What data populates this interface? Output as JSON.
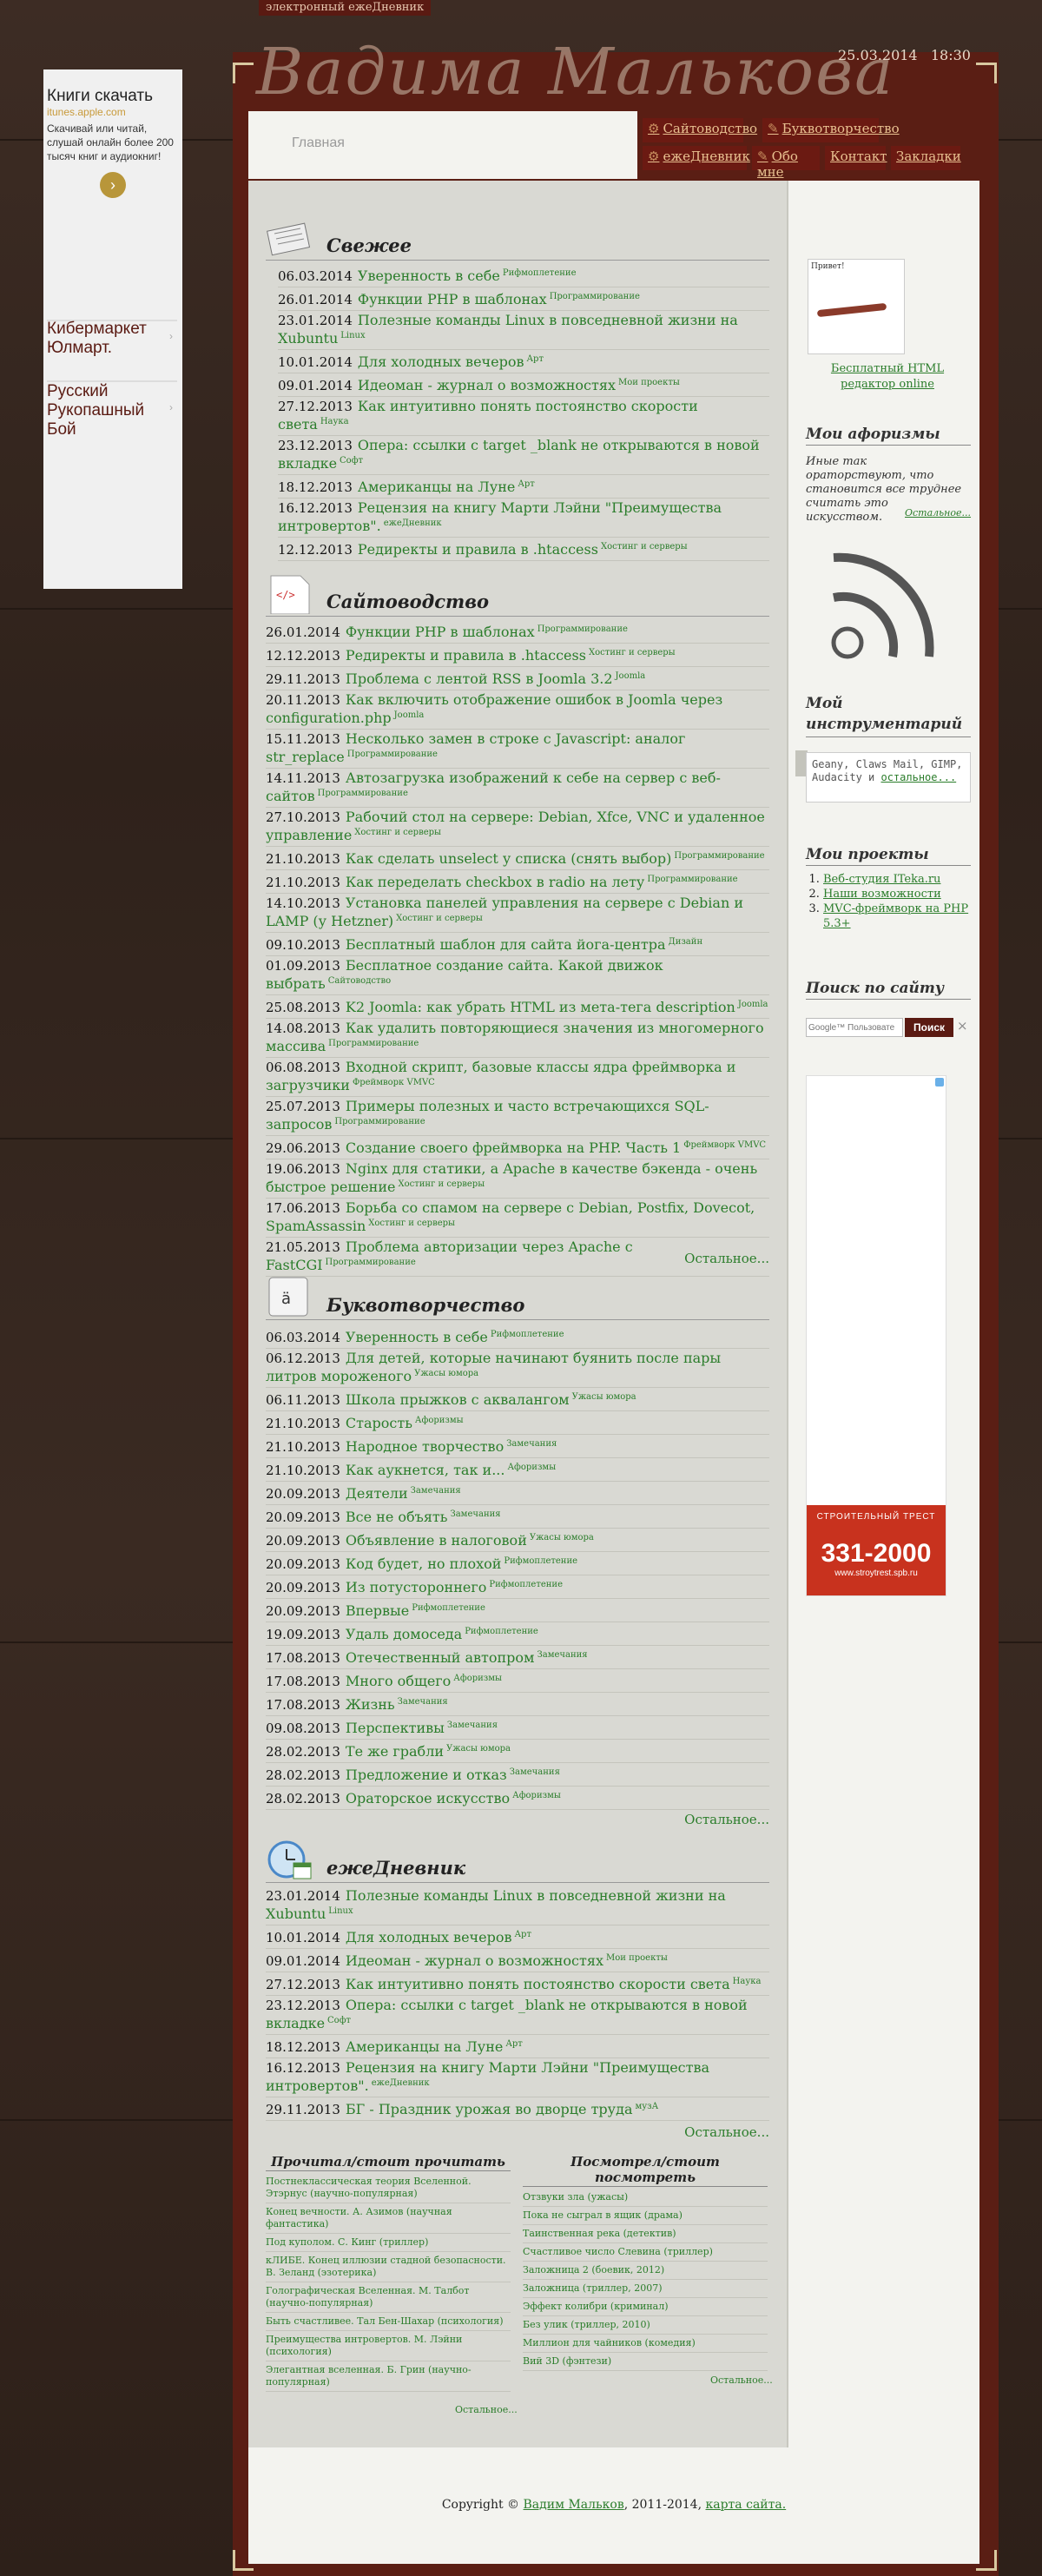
{
  "site": {
    "top_label": "электронный ежеДневник",
    "logo": "Вадима Малькова",
    "date": "25.03.2014",
    "time": "18:30",
    "home": "Главная"
  },
  "nav": [
    {
      "label": "Сайтоводство"
    },
    {
      "label": "Буквотворчество"
    },
    {
      "label": "ежеДневник"
    },
    {
      "label": "Обо мне"
    },
    {
      "label": "Контакт"
    },
    {
      "label": "Закладки"
    }
  ],
  "left_ad": {
    "title": "Книги скачать",
    "domain": "itunes.apple.com",
    "text": "Скачивай или читай, слушай онлайн более 200 тысяч книг и аудиокниг!",
    "link1": "Кибермаркет Юлмарт.",
    "link2": "Русский Рукопашный Бой"
  },
  "fresh": {
    "title": "Свежее",
    "items": [
      {
        "date": "06.03.2014",
        "title": "Уверенность в себе",
        "tag": "Рифмоплетение"
      },
      {
        "date": "26.01.2014",
        "title": "Функции PHP в шаблонах",
        "tag": "Программирование"
      },
      {
        "date": "23.01.2014",
        "title": "Полезные команды Linux в повседневной жизни на Xubuntu",
        "tag": "Linux"
      },
      {
        "date": "10.01.2014",
        "title": "Для холодных вечеров",
        "tag": "Арт"
      },
      {
        "date": "09.01.2014",
        "title": "Идеоман - журнал о возможностях",
        "tag": "Мои проекты"
      },
      {
        "date": "27.12.2013",
        "title": "Как интуитивно понять постоянство скорости света",
        "tag": "Наука"
      },
      {
        "date": "23.12.2013",
        "title": "Опера: ссылки с target _blank не открываются в новой вкладке",
        "tag": "Софт"
      },
      {
        "date": "18.12.2013",
        "title": "Американцы на Луне",
        "tag": "Арт"
      },
      {
        "date": "16.12.2013",
        "title": "Рецензия на книгу Марти Лэйни \"Преимущества интровертов\".",
        "tag": "ежеДневник"
      },
      {
        "date": "12.12.2013",
        "title": "Редиректы и правила в .htaccess",
        "tag": "Хостинг и серверы"
      }
    ]
  },
  "web": {
    "title": "Сайтоводство",
    "more": "Остальное...",
    "items": [
      {
        "date": "26.01.2014",
        "title": "Функции PHP в шаблонах",
        "tag": "Программирование"
      },
      {
        "date": "12.12.2013",
        "title": "Редиректы и правила в .htaccess",
        "tag": "Хостинг и серверы"
      },
      {
        "date": "29.11.2013",
        "title": "Проблема с лентой RSS в Joomla 3.2",
        "tag": "Joomla"
      },
      {
        "date": "20.11.2013",
        "title": "Как включить отображение ошибок в Joomla через configuration.php",
        "tag": "Joomla"
      },
      {
        "date": "15.11.2013",
        "title": "Несколько замен в строке с Javascript: аналог str_replace",
        "tag": "Программирование"
      },
      {
        "date": "14.11.2013",
        "title": "Автозагрузка изображений к себе на сервер с веб-сайтов",
        "tag": "Программирование"
      },
      {
        "date": "27.10.2013",
        "title": "Рабочий стол на сервере: Debian, Xfce, VNC и удаленное управление",
        "tag": "Хостинг и серверы"
      },
      {
        "date": "21.10.2013",
        "title": "Как сделать unselect у списка (снять выбор)",
        "tag": "Программирование"
      },
      {
        "date": "21.10.2013",
        "title": "Как переделать checkbox в radio на лету",
        "tag": "Программирование"
      },
      {
        "date": "14.10.2013",
        "title": "Установка панелей управления на сервере с Debian и LAMP (у Hetzner)",
        "tag": "Хостинг и серверы"
      },
      {
        "date": "09.10.2013",
        "title": "Бесплатный шаблон для сайта йога-центра",
        "tag": "Дизайн"
      },
      {
        "date": "01.09.2013",
        "title": "Бесплатное создание сайта. Какой движок выбрать",
        "tag": "Сайтоводство"
      },
      {
        "date": "25.08.2013",
        "title": "K2 Joomla: как убрать HTML из мета-тега description",
        "tag": "Joomla"
      },
      {
        "date": "14.08.2013",
        "title": "Как удалить повторяющиеся значения из многомерного массива",
        "tag": "Программирование"
      },
      {
        "date": "06.08.2013",
        "title": "Входной скрипт, базовые классы ядра фреймворка и загрузчики",
        "tag": "Фреймворк VMVC"
      },
      {
        "date": "25.07.2013",
        "title": "Примеры полезных и часто встречающихся SQL-запросов",
        "tag": "Программирование"
      },
      {
        "date": "29.06.2013",
        "title": "Создание своего фреймворка на PHP. Часть 1",
        "tag": "Фреймворк VMVC"
      },
      {
        "date": "19.06.2013",
        "title": "Nginx для статики, а Apache в качестве бэкенда - очень быстрое решение",
        "tag": "Хостинг и серверы"
      },
      {
        "date": "17.06.2013",
        "title": "Борьба со спамом на сервере с Debian, Postfix, Dovecot, SpamAssassin",
        "tag": "Хостинг и серверы"
      },
      {
        "date": "21.05.2013",
        "title": "Проблема авторизации через Apache с FastCGI",
        "tag": "Программирование"
      }
    ]
  },
  "letters": {
    "title": "Буквотворчество",
    "more": "Остальное...",
    "items": [
      {
        "date": "06.03.2014",
        "title": "Уверенность в себе",
        "tag": "Рифмоплетение"
      },
      {
        "date": "06.12.2013",
        "title": "Для детей, которые начинают буянить после пары литров мороженого",
        "tag": "Ужасы юмора"
      },
      {
        "date": "06.11.2013",
        "title": "Школа прыжков с аквалангом",
        "tag": "Ужасы юмора"
      },
      {
        "date": "21.10.2013",
        "title": "Старость",
        "tag": "Афоризмы"
      },
      {
        "date": "21.10.2013",
        "title": "Народное творчество",
        "tag": "Замечания"
      },
      {
        "date": "21.10.2013",
        "title": "Как аукнется, так и...",
        "tag": "Афоризмы"
      },
      {
        "date": "20.09.2013",
        "title": "Деятели",
        "tag": "Замечания"
      },
      {
        "date": "20.09.2013",
        "title": "Все не объять",
        "tag": "Замечания"
      },
      {
        "date": "20.09.2013",
        "title": "Объявление в налоговой",
        "tag": "Ужасы юмора"
      },
      {
        "date": "20.09.2013",
        "title": "Код будет, но плохой",
        "tag": "Рифмоплетение"
      },
      {
        "date": "20.09.2013",
        "title": "Из потустороннего",
        "tag": "Рифмоплетение"
      },
      {
        "date": "20.09.2013",
        "title": "Впервые",
        "tag": "Рифмоплетение"
      },
      {
        "date": "19.09.2013",
        "title": "Удаль домоседа",
        "tag": "Рифмоплетение"
      },
      {
        "date": "17.08.2013",
        "title": "Отечественный автопром",
        "tag": "Замечания"
      },
      {
        "date": "17.08.2013",
        "title": "Много общего",
        "tag": "Афоризмы"
      },
      {
        "date": "17.08.2013",
        "title": "Жизнь",
        "tag": "Замечания"
      },
      {
        "date": "09.08.2013",
        "title": "Перспективы",
        "tag": "Замечания"
      },
      {
        "date": "28.02.2013",
        "title": "Те же грабли",
        "tag": "Ужасы юмора"
      },
      {
        "date": "28.02.2013",
        "title": "Предложение и отказ",
        "tag": "Замечания"
      },
      {
        "date": "28.02.2013",
        "title": "Ораторское искусство",
        "tag": "Афоризмы"
      }
    ]
  },
  "diary": {
    "title": "ежеДневник",
    "more": "Остальное...",
    "items": [
      {
        "date": "23.01.2014",
        "title": "Полезные команды Linux в повседневной жизни на Xubuntu",
        "tag": "Linux"
      },
      {
        "date": "10.01.2014",
        "title": "Для холодных вечеров",
        "tag": "Арт"
      },
      {
        "date": "09.01.2014",
        "title": "Идеоман - журнал о возможностях",
        "tag": "Мои проекты"
      },
      {
        "date": "27.12.2013",
        "title": "Как интуитивно понять постоянство скорости света",
        "tag": "Наука"
      },
      {
        "date": "23.12.2013",
        "title": "Опера: ссылки с target _blank не открываются в новой вкладке",
        "tag": "Софт"
      },
      {
        "date": "18.12.2013",
        "title": "Американцы на Луне",
        "tag": "Арт"
      },
      {
        "date": "16.12.2013",
        "title": "Рецензия на книгу Марти Лэйни \"Преимущества интровертов\".",
        "tag": "ежеДневник"
      },
      {
        "date": "29.11.2013",
        "title": "БГ - Праздник урожая во дворце труда",
        "tag": "музА"
      }
    ]
  },
  "reading": {
    "title": "Прочитал/стоит прочитать",
    "more": "Остальное...",
    "items": [
      "Постнеклассическая теория Вселенной. Этэрнус (научно-популярная)",
      "Конец вечности. А. Азимов (научная фантастика)",
      "Под куполом. С. Кинг (триллер)",
      "кЛИБЕ. Конец иллюзии стадной безопасности. В. Зеланд (эзотерика)",
      "Голографическая Вселенная. М. Талбот (научно-популярная)",
      "Быть счастливее. Тал Бен-Шахар (психология)",
      "Преимущества интровертов. М. Лэйни (психология)",
      "Элегантная вселенная. Б. Грин (научно-популярная)"
    ]
  },
  "watching": {
    "title": "Посмотрел/стоит посмотреть",
    "more": "Остальное...",
    "items": [
      "Отзвуки зла (ужасы)",
      "Пока не сыграл в ящик (драма)",
      "Таинственная река (детектив)",
      "Счастливое число Слевина (триллер)",
      "Заложница 2 (боевик, 2012)",
      "Заложница (триллер, 2007)",
      "Эффект колибри (криминал)",
      "Без улик (триллер, 2010)",
      "Миллион для чайников (комедия)",
      "Вий 3D (фэнтези)"
    ]
  },
  "sidebar": {
    "editor_link": "Бесплатный HTML редактор online",
    "editor_thumb": "Привет!",
    "aphorisms_title": "Мои афоризмы",
    "aphorism": "Иные так ораторствуют, что становится все труднее считать это искусством.",
    "aphorism_more": "Остальное...",
    "tools_title": "Мой инструментарий",
    "tools_text": "Geany, Claws Mail, GIMP, Audacity и",
    "tools_more": "остальное...",
    "projects_title": "Мои проекты",
    "projects": [
      "Веб-студия ITeka.ru",
      "Наши возможности",
      "MVC-фреймворк на PHP 5.3+"
    ],
    "search_title": "Поиск по сайту",
    "search_placeholder": "Google™ Пользовате",
    "search_button": "Поиск",
    "ad_brand": "СТРОИТЕЛЬНЫЙ ТРЕСТ",
    "ad_phone": "331-2000",
    "ad_site": "www.stroytrest.spb.ru"
  },
  "footer": {
    "copyright": "Copyright ©",
    "author": "Вадим Мальков",
    "years": ", 2011-2014,",
    "sitemap": "карта сайта."
  }
}
